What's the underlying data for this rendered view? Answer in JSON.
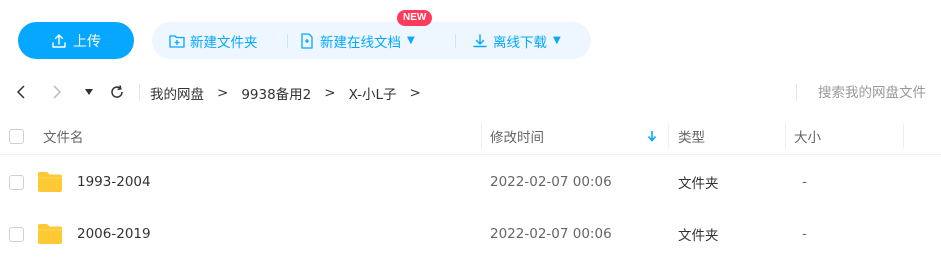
{
  "toolbar": {
    "upload_label": "上传",
    "new_folder_label": "新建文件夹",
    "new_online_doc_label": "新建在线文档",
    "new_badge": "NEW",
    "offline_download_label": "离线下载"
  },
  "nav": {
    "breadcrumbs": [
      "我的网盘",
      "9938备用2",
      "X-小L子"
    ],
    "search_placeholder": "搜索我的网盘文件"
  },
  "table": {
    "headers": {
      "name": "文件名",
      "modified": "修改时间",
      "type": "类型",
      "size": "大小"
    },
    "rows": [
      {
        "name": "1993-2004",
        "modified": "2022-02-07 00:06",
        "type": "文件夹",
        "size": "-"
      },
      {
        "name": "2006-2019",
        "modified": "2022-02-07 00:06",
        "type": "文件夹",
        "size": "-"
      }
    ]
  },
  "colors": {
    "accent": "#06a7ff",
    "action_bg": "#eef7ff",
    "badge": "#ff3b5c",
    "folder": "#ffc933"
  }
}
